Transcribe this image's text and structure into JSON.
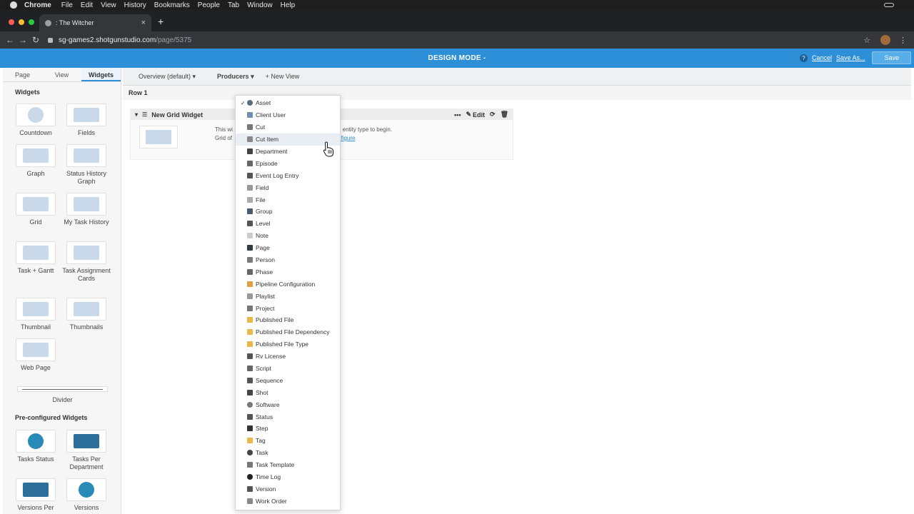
{
  "os_menubar": {
    "app": "Chrome",
    "items": [
      "File",
      "Edit",
      "View",
      "History",
      "Bookmarks",
      "People",
      "Tab",
      "Window",
      "Help"
    ]
  },
  "browser": {
    "tab_title": ": The Witcher",
    "url_host": "sg-games2.shotgunstudio.com",
    "url_path": "/page/5375"
  },
  "header": {
    "title": "DESIGN MODE -",
    "help": "?",
    "cancel": "Cancel",
    "save_as": "Save As...",
    "save": "Save"
  },
  "left_panel": {
    "tabs": [
      "Page",
      "View",
      "Widgets"
    ],
    "active_tab": "Widgets",
    "widgets_heading": "Widgets",
    "widgets": [
      "Countdown",
      "Fields",
      "Graph",
      "Status History Graph",
      "Grid",
      "My Task History",
      "Task + Gantt",
      "Task Assignment Cards",
      "Thumbnail",
      "Thumbnails",
      "Web Page"
    ],
    "divider_label": "Divider",
    "preconfigured_heading": "Pre-configured Widgets",
    "preconfigured": [
      "Tasks Status",
      "Tasks Per Department",
      "Versions Per",
      "Versions"
    ]
  },
  "main": {
    "view_tabs": [
      "Overview (default) ▾",
      "Producers ▾",
      "+ New View"
    ],
    "active_view": "Producers ▾",
    "row_label": "Row 1",
    "grid_widget": {
      "title": "New Grid Widget",
      "edit": "Edit",
      "text_line1": "This wi",
      "text_line2": "Grid of",
      "text2_line1": "n entity type to begin.",
      "text2_link": "nfigure"
    }
  },
  "dropdown": {
    "selected": "Asset",
    "hovered": "Cut Item",
    "items": [
      "Asset",
      "Client User",
      "Cut",
      "Cut Item",
      "Department",
      "Episode",
      "Event Log Entry",
      "Field",
      "File",
      "Group",
      "Level",
      "Note",
      "Page",
      "Person",
      "Phase",
      "Pipeline Configuration",
      "Playlist",
      "Project",
      "Published File",
      "Published File Dependency",
      "Published File Type",
      "Rv License",
      "Script",
      "Sequence",
      "Shot",
      "Software",
      "Status",
      "Step",
      "Tag",
      "Task",
      "Task Template",
      "Time Log",
      "Version",
      "Work Order"
    ]
  },
  "colors": {
    "header_blue": "#2d8fd8",
    "link_blue": "#2d8fd8"
  }
}
